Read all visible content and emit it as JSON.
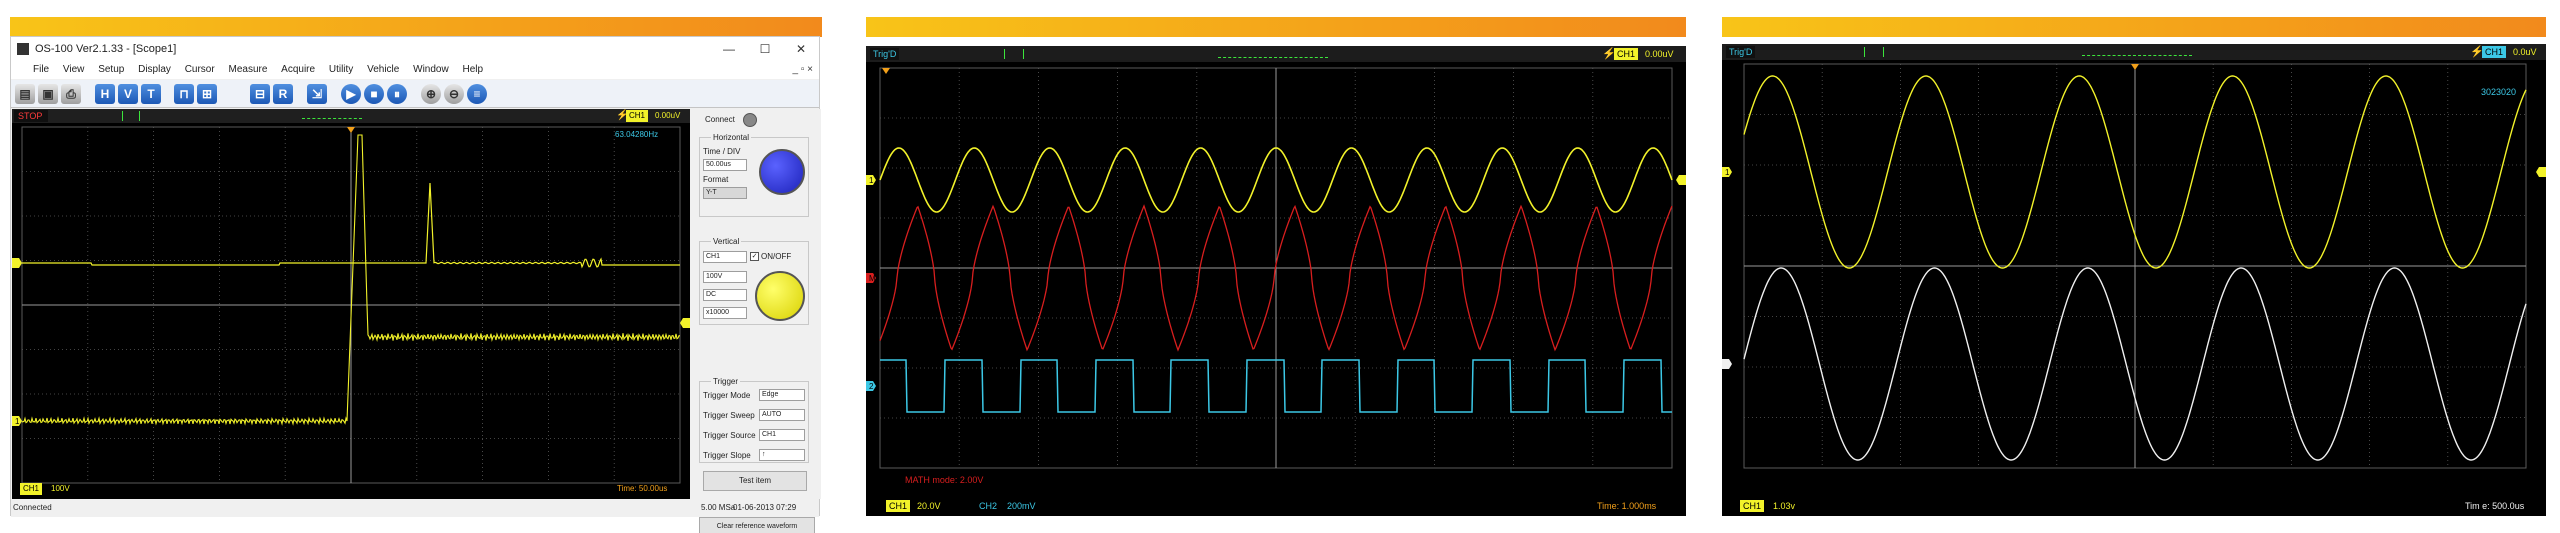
{
  "colors": {
    "yellow": "#f2f22a",
    "red": "#d81e1e",
    "cyan": "#3cc8e6",
    "white": "#f0f0f0",
    "grid": "#5a5a5a",
    "accent_strip": "#f4a11a"
  },
  "panel1": {
    "window_title": "OS-100 Ver2.1.33 - [Scope1]",
    "menu": [
      "File",
      "View",
      "Setup",
      "Display",
      "Cursor",
      "Measure",
      "Acquire",
      "Utility",
      "Vehicle",
      "Window",
      "Help"
    ],
    "toolbar_icons": [
      "new-icon",
      "save-icon",
      "print-icon",
      "h-cursor-icon",
      "v-cursor-icon",
      "t-icon",
      "measure-icon",
      "zoom-icon",
      "r-icon",
      "run-icon",
      "stop-icon",
      "step-icon",
      "zoom-in-icon",
      "zoom-out-icon",
      "fit-icon"
    ],
    "status_tag": "STOP",
    "trigger_readout": "0.00uV",
    "channel_tag": "CH1",
    "frequency": "63.04280Hz",
    "bottom_left_channel": "CH1",
    "bottom_left_value": "100V",
    "bottom_right_time": "Time: 50.00us",
    "side": {
      "connect_label": "Connect",
      "horizontal_label": "Horizontal",
      "time_div_label": "Time / DIV",
      "time_div_value": "50.00us",
      "format_label": "Format",
      "format_value": "Y-T",
      "vertical_label": "Vertical",
      "channel_select": "CH1",
      "onoff_label": "ON/OFF",
      "volts_value": "100V",
      "coupling_value": "DC",
      "probe_value": "x10000",
      "trigger_label": "Trigger",
      "trigger_rows": [
        {
          "label": "Trigger Mode",
          "value": "Edge"
        },
        {
          "label": "Trigger Sweep",
          "value": "AUTO"
        },
        {
          "label": "Trigger Source",
          "value": "CH1"
        },
        {
          "label": "Trigger Slope",
          "value": "↑"
        }
      ],
      "test_button": "Test item",
      "clear_button": "Clear reference waveform"
    },
    "statusbar": {
      "left": "Connected",
      "rate": "5.00 MSa",
      "datetime": "01-06-2013  07:29"
    }
  },
  "panel2": {
    "status_tag": "Trig'D",
    "trigger_readout": "0.00uV",
    "channel_tag": "CH1",
    "math_label": "MATH mode: 2.00V",
    "ch1_label": "CH1",
    "ch1_value": "20.0V",
    "ch2_label": "CH2",
    "ch2_value": "200mV",
    "time_label": "Time: 1.000ms",
    "marker_labels": [
      "1",
      "M",
      "2"
    ]
  },
  "panel3": {
    "status_tag": "Trig'D",
    "trigger_readout": "0.0uV",
    "channel_tag": "CH1",
    "frequency": "3023020",
    "ch1_label": "CH1",
    "ch1_value": "1.03v",
    "time_label": "Tim e: 500.0us",
    "marker_labels": [
      "1"
    ]
  }
}
